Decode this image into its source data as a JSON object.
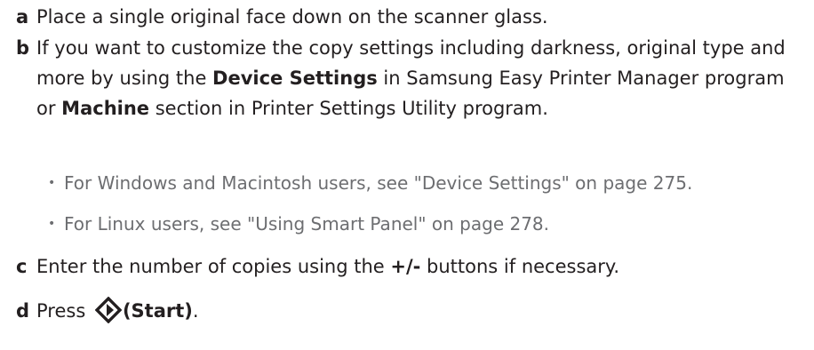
{
  "steps": {
    "a": {
      "letter": "a",
      "text": "Place a single original face down on the scanner glass."
    },
    "b": {
      "letter": "b",
      "text_1": "If you want to customize the copy settings including darkness, original type and more by using the ",
      "bold_1": "Device Settings",
      "text_2": " in Samsung Easy Printer Manager program or ",
      "bold_2": "Machine",
      "text_3": " section in Printer Settings Utility program."
    },
    "c": {
      "letter": "c",
      "text_1": "Enter the number of copies using the ",
      "bold_1": "+/-",
      "text_2": " buttons if necessary."
    },
    "d": {
      "letter": "d",
      "text_1": "Press ",
      "icon": "start-button-icon",
      "bold_1": "(Start)",
      "text_2": "."
    }
  },
  "bullets": [
    {
      "dot": "•",
      "text": "For Windows and Macintosh users, see \"Device Settings\" on page 275."
    },
    {
      "dot": "•",
      "text": "For Linux users, see \"Using Smart Panel\" on page 278."
    }
  ],
  "colors": {
    "text": "#231f20",
    "bullet_text": "#6d6e71"
  }
}
